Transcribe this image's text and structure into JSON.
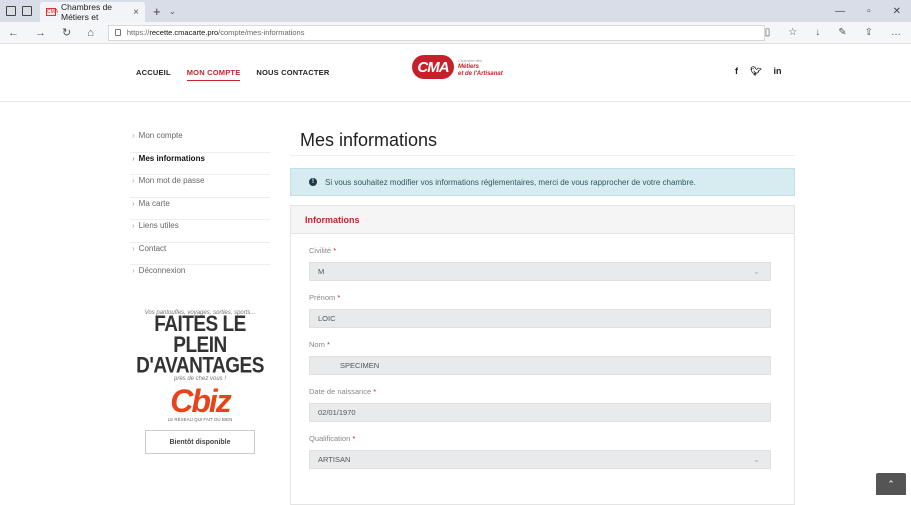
{
  "browser": {
    "tab_title": "Chambres de Métiers et",
    "favicon_text": "CMA",
    "url_prefix": "https://",
    "url_domain": "recette.cmacarte.pro",
    "url_path": "/compte/mes-informations",
    "icons": [
      "back-icon",
      "forward-icon",
      "refresh-icon",
      "home-icon",
      "reader-icon",
      "favorite-icon",
      "download-icon",
      "pen-icon",
      "share-icon",
      "more-icon"
    ]
  },
  "header": {
    "menu": [
      {
        "label": "ACCUEIL"
      },
      {
        "label": "MON COMPTE"
      },
      {
        "label": "NOUS CONTACTER"
      }
    ],
    "logo": {
      "mark": "CMA",
      "line1": "Chambre des",
      "line2": "Métiers",
      "line3": "et de l'Artisanat"
    },
    "social": {
      "facebook": "f",
      "twitter": "♥",
      "linkedin": "in"
    }
  },
  "sidebar": {
    "items": [
      {
        "label": "Mon compte"
      },
      {
        "label": "Mes informations"
      },
      {
        "label": "Mon mot de passe"
      },
      {
        "label": "Ma carte"
      },
      {
        "label": "Liens utiles"
      },
      {
        "label": "Contact"
      },
      {
        "label": "Déconnexion"
      }
    ]
  },
  "promo": {
    "tagline": "Vos pantoufles, voyages, sorties, sports...",
    "headline_1": "FAITES LE PLEIN",
    "headline_2": "D'AVANTAGES",
    "sub": "près de chez vous !",
    "brand": "Cbiz",
    "slogan": "LE RÉSEAU QUI FAIT DU BIEN",
    "button": "Bientôt disponible"
  },
  "main": {
    "title": "Mes informations",
    "alert_icon": "!",
    "alert": "Si vous souhaitez modifier vos informations réglementaires, merci de vous rapprocher de votre chambre.",
    "section_title": "Informations",
    "required_mark": "*",
    "fields": [
      {
        "label": "Civilité",
        "value": "M",
        "type": "select"
      },
      {
        "label": "Prénom",
        "value": "LOIC",
        "type": "text"
      },
      {
        "label": "Nom",
        "value": "SPECIMEN",
        "type": "text"
      },
      {
        "label": "Date de naissance",
        "value": "02/01/1970",
        "type": "text"
      },
      {
        "label": "Qualification",
        "value": "ARTISAN",
        "type": "select"
      }
    ]
  },
  "colors": {
    "accent": "#c0272d",
    "alert_bg": "#d7ecf0"
  }
}
